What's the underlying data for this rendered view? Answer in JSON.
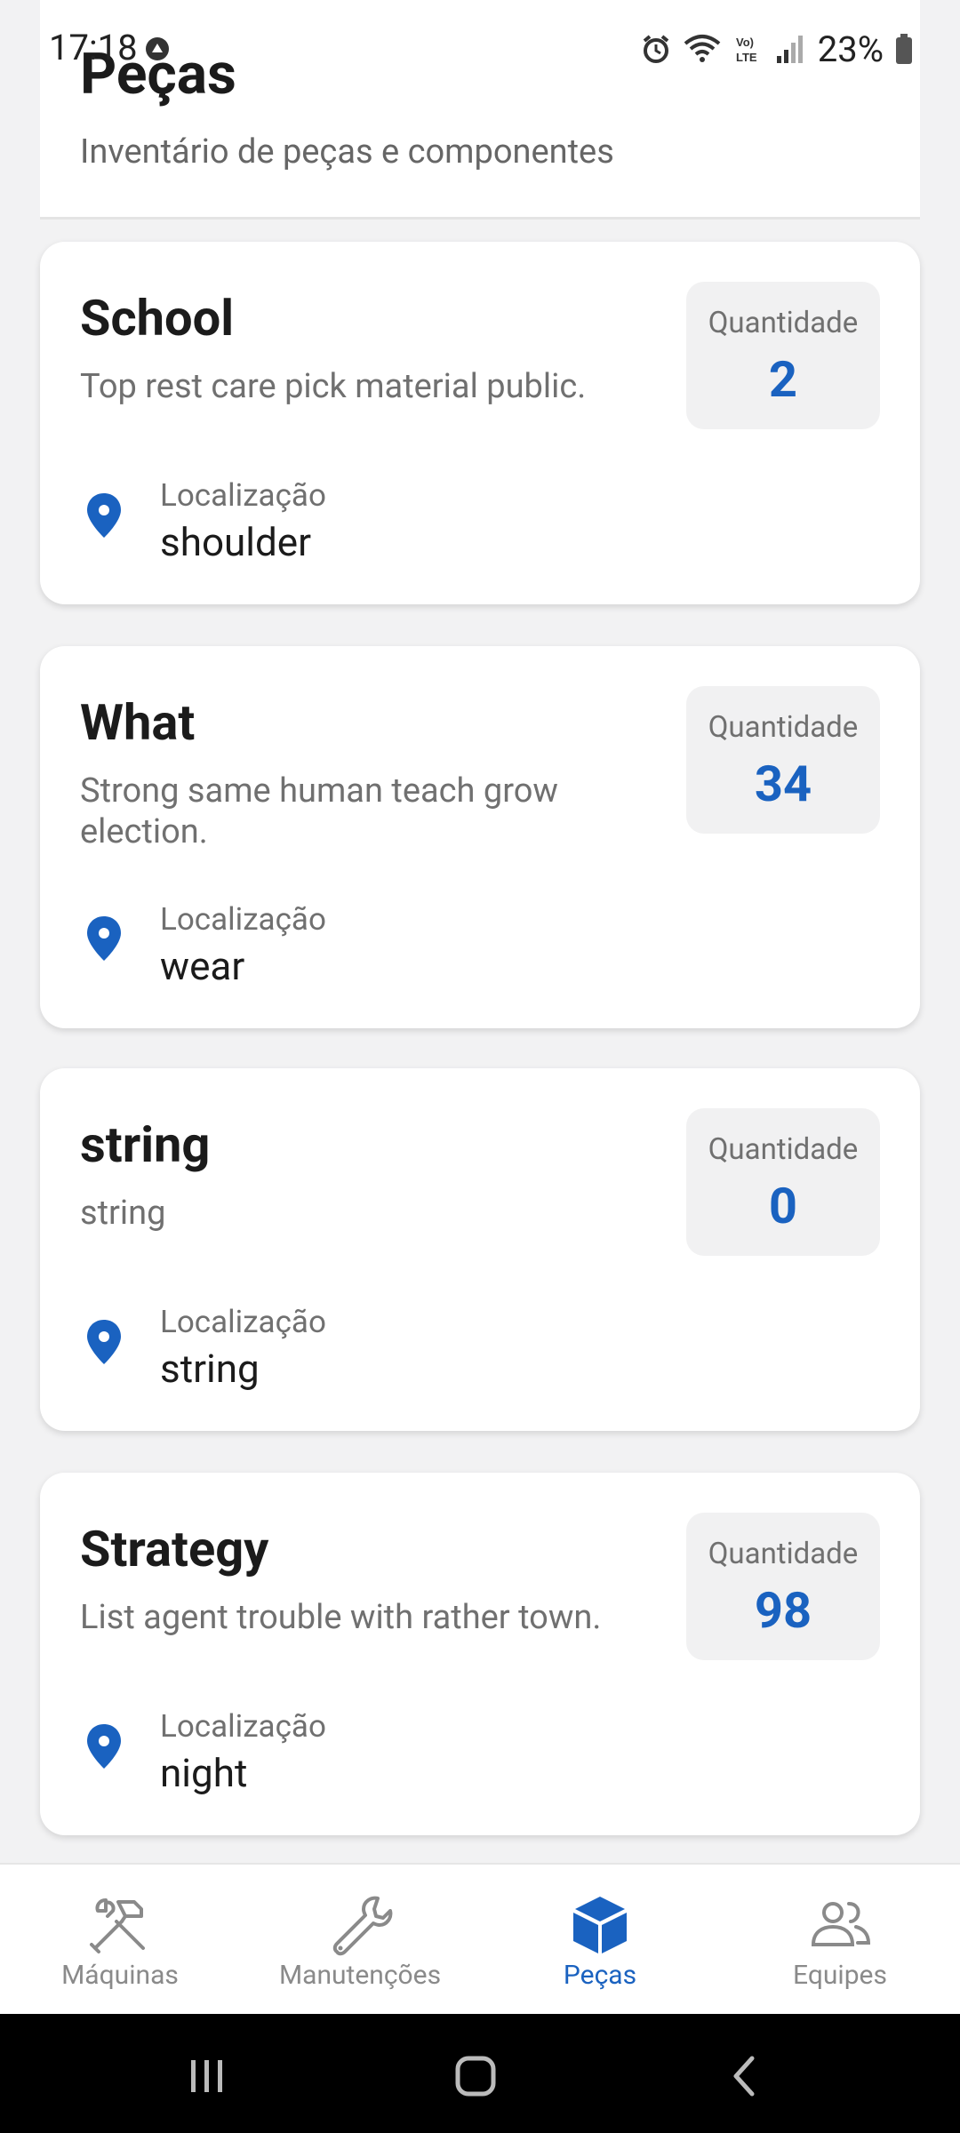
{
  "status_bar": {
    "time": "17:18",
    "battery": "23%"
  },
  "header": {
    "title": "Peças",
    "subtitle": "Inventário de peças e componentes"
  },
  "cards": [
    {
      "name": "School",
      "description": "Top rest care pick material public.",
      "quantity_label": "Quantidade",
      "quantity": "2",
      "location_label": "Localização",
      "location": "shoulder"
    },
    {
      "name": "What",
      "description": "Strong same human teach grow election.",
      "quantity_label": "Quantidade",
      "quantity": "34",
      "location_label": "Localização",
      "location": "wear"
    },
    {
      "name": "string",
      "description": "string",
      "quantity_label": "Quantidade",
      "quantity": "0",
      "location_label": "Localização",
      "location": "string"
    },
    {
      "name": "Strategy",
      "description": "List agent trouble with rather town.",
      "quantity_label": "Quantidade",
      "quantity": "98",
      "location_label": "Localização",
      "location": "night"
    }
  ],
  "bottom_nav": {
    "items": [
      {
        "label": "Máquinas",
        "icon": "tools-icon"
      },
      {
        "label": "Manutenções",
        "icon": "wrench-icon"
      },
      {
        "label": "Peças",
        "icon": "cube-icon",
        "active": true
      },
      {
        "label": "Equipes",
        "icon": "people-icon"
      }
    ]
  },
  "colors": {
    "accent": "#1a62c0",
    "inactive": "#8a8a8a",
    "background": "#f2f2f3"
  }
}
